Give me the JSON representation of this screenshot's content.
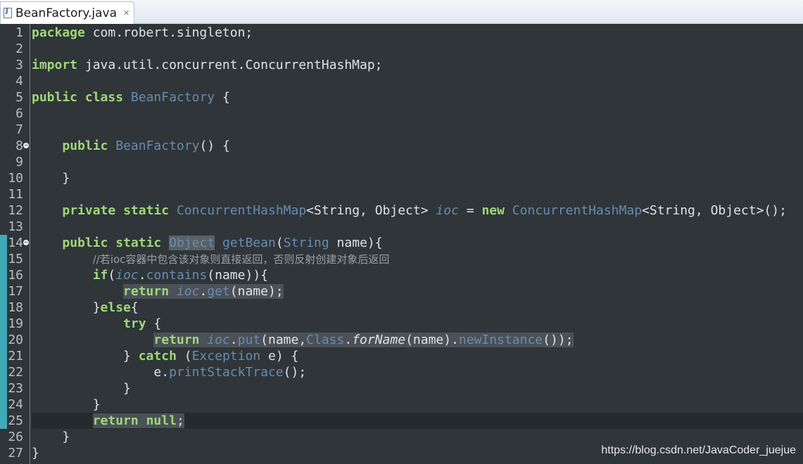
{
  "tab": {
    "title": "BeanFactory.java",
    "close_glyph": "✕"
  },
  "editor": {
    "lines": [
      {
        "n": "1",
        "tokens": [
          {
            "t": "package",
            "c": "kw"
          },
          {
            "t": " com.robert.singleton;"
          }
        ]
      },
      {
        "n": "2",
        "tokens": []
      },
      {
        "n": "3",
        "tokens": [
          {
            "t": "import",
            "c": "kw"
          },
          {
            "t": " java.util.concurrent.ConcurrentHashMap;"
          }
        ]
      },
      {
        "n": "4",
        "tokens": []
      },
      {
        "n": "5",
        "tokens": [
          {
            "t": "public",
            "c": "kw"
          },
          {
            "t": " "
          },
          {
            "t": "class",
            "c": "kw"
          },
          {
            "t": " "
          },
          {
            "t": "BeanFactory",
            "c": "typ"
          },
          {
            "t": " {"
          }
        ]
      },
      {
        "n": "6",
        "tokens": []
      },
      {
        "n": "7",
        "tokens": []
      },
      {
        "n": "8",
        "fold": true,
        "tokens": [
          {
            "t": "    "
          },
          {
            "t": "public",
            "c": "kw"
          },
          {
            "t": " "
          },
          {
            "t": "BeanFactory",
            "c": "mth"
          },
          {
            "t": "() {"
          }
        ]
      },
      {
        "n": "9",
        "tokens": []
      },
      {
        "n": "10",
        "tokens": [
          {
            "t": "    }"
          }
        ]
      },
      {
        "n": "11",
        "tokens": []
      },
      {
        "n": "12",
        "tokens": [
          {
            "t": "    "
          },
          {
            "t": "private",
            "c": "kw"
          },
          {
            "t": " "
          },
          {
            "t": "static",
            "c": "kw"
          },
          {
            "t": " "
          },
          {
            "t": "ConcurrentHashMap",
            "c": "typ"
          },
          {
            "t": "<String, Object> "
          },
          {
            "t": "ioc",
            "c": "fld"
          },
          {
            "t": " = "
          },
          {
            "t": "new",
            "c": "kw"
          },
          {
            "t": " "
          },
          {
            "t": "ConcurrentHashMap",
            "c": "typ"
          },
          {
            "t": "<String, Object>();"
          }
        ]
      },
      {
        "n": "13",
        "tokens": []
      },
      {
        "n": "14",
        "fold": true,
        "tokens": [
          {
            "t": "    "
          },
          {
            "t": "public",
            "c": "kw"
          },
          {
            "t": " "
          },
          {
            "t": "static",
            "c": "kw"
          },
          {
            "t": " "
          },
          {
            "t": "Object",
            "c": "typ hlw"
          },
          {
            "t": " "
          },
          {
            "t": "getBean",
            "c": "mth"
          },
          {
            "t": "("
          },
          {
            "t": "String",
            "c": "typ"
          },
          {
            "t": " name){"
          }
        ]
      },
      {
        "n": "15",
        "tokens": [
          {
            "t": "        "
          },
          {
            "t": "//若",
            "c": "cmt"
          },
          {
            "t": "ioc",
            "c": "cmt sq"
          },
          {
            "t": "容器中包含该对象则直接返回，否则反射创建对象后返回",
            "c": "cmt"
          }
        ]
      },
      {
        "n": "16",
        "tokens": [
          {
            "t": "        "
          },
          {
            "t": "if",
            "c": "kw"
          },
          {
            "t": "("
          },
          {
            "t": "ioc",
            "c": "fld"
          },
          {
            "t": "."
          },
          {
            "t": "contains",
            "c": "mth"
          },
          {
            "t": "(name)){"
          }
        ]
      },
      {
        "n": "17",
        "tokens": [
          {
            "t": "            "
          },
          {
            "t": "return",
            "c": "kw hl"
          },
          {
            "t": " ",
            "c": "hl"
          },
          {
            "t": "ioc",
            "c": "fld hl"
          },
          {
            "t": ".",
            "c": "hl"
          },
          {
            "t": "get",
            "c": "mth hl"
          },
          {
            "t": "(name);",
            "c": "hl"
          }
        ]
      },
      {
        "n": "18",
        "tokens": [
          {
            "t": "        }"
          },
          {
            "t": "else",
            "c": "kw"
          },
          {
            "t": "{"
          }
        ]
      },
      {
        "n": "19",
        "tokens": [
          {
            "t": "            "
          },
          {
            "t": "try",
            "c": "kw"
          },
          {
            "t": " {"
          }
        ]
      },
      {
        "n": "20",
        "tokens": [
          {
            "t": "                "
          },
          {
            "t": "return",
            "c": "kw hl"
          },
          {
            "t": " ",
            "c": "hl"
          },
          {
            "t": "ioc",
            "c": "fld hl"
          },
          {
            "t": ".",
            "c": "hl"
          },
          {
            "t": "put",
            "c": "mth hl"
          },
          {
            "t": "(name,",
            "c": "hl"
          },
          {
            "t": "Class",
            "c": "typ hl"
          },
          {
            "t": ".",
            "c": "hl"
          },
          {
            "t": "forName",
            "c": "sfn hl"
          },
          {
            "t": "(name).",
            "c": "hl"
          },
          {
            "t": "newInstance",
            "c": "mth hl"
          },
          {
            "t": "());",
            "c": "hl"
          }
        ]
      },
      {
        "n": "21",
        "tokens": [
          {
            "t": "            } "
          },
          {
            "t": "catch",
            "c": "kw"
          },
          {
            "t": " ("
          },
          {
            "t": "Exception",
            "c": "typ"
          },
          {
            "t": " e) {"
          }
        ]
      },
      {
        "n": "22",
        "tokens": [
          {
            "t": "                e."
          },
          {
            "t": "printStackTrace",
            "c": "mth"
          },
          {
            "t": "();"
          }
        ]
      },
      {
        "n": "23",
        "tokens": [
          {
            "t": "            }"
          }
        ]
      },
      {
        "n": "24",
        "tokens": [
          {
            "t": "        }"
          }
        ]
      },
      {
        "n": "25",
        "current": true,
        "tokens": [
          {
            "t": "        "
          },
          {
            "t": "return",
            "c": "kw hl"
          },
          {
            "t": " ",
            "c": "hl"
          },
          {
            "t": "null",
            "c": "kw hl"
          },
          {
            "t": ";",
            "c": "hl"
          }
        ]
      },
      {
        "n": "26",
        "tokens": [
          {
            "t": "    }"
          }
        ]
      },
      {
        "n": "27",
        "tokens": [
          {
            "t": "}"
          }
        ]
      }
    ]
  },
  "watermark": "https://blog.csdn.net/JavaCoder_juejue",
  "colors": {
    "background": "#2f3538",
    "keyword": "#9ed77a",
    "type": "#678cb1",
    "text": "#e0e2e4",
    "ruler_marker": "#3fa9b8"
  },
  "icons": {
    "tab_file": "java-file-icon",
    "tab_close": "close-icon",
    "fold": "fold-toggle-icon"
  }
}
